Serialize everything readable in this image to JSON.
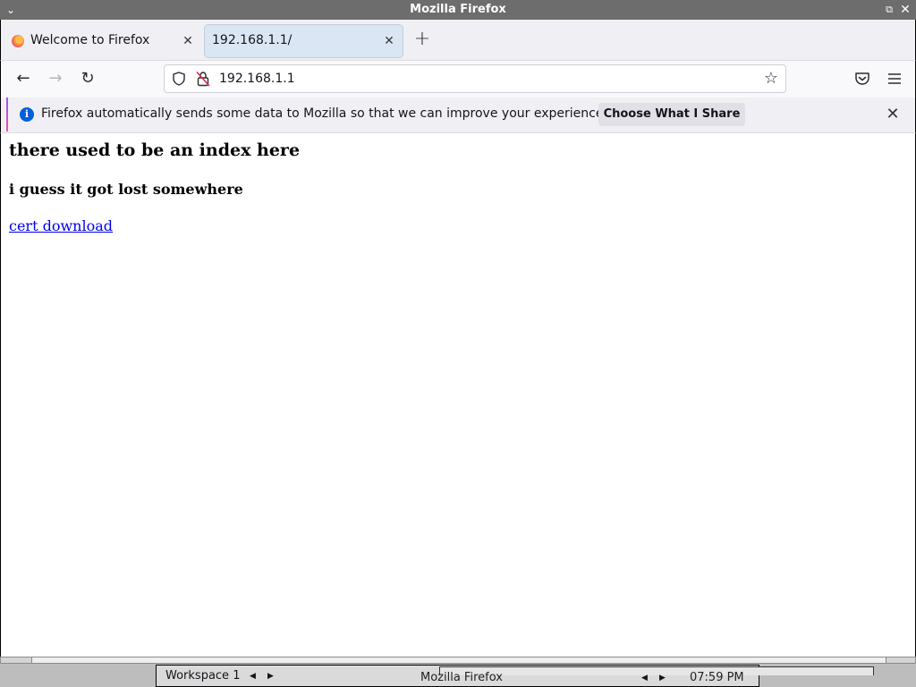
{
  "window": {
    "title": "Mozilla Firefox",
    "menu_glyph": "⌄",
    "restore_glyph": "⧉",
    "close_glyph": "✕"
  },
  "tabs": [
    {
      "label": "Welcome to Firefox",
      "active": false,
      "icon": "firefox-icon"
    },
    {
      "label": "192.168.1.1/",
      "active": true
    }
  ],
  "tab_close_glyph": "✕",
  "new_tab_glyph": "+",
  "nav": {
    "back_glyph": "←",
    "forward_glyph": "→",
    "reload_glyph": "↻",
    "url": "192.168.1.1",
    "bookmark_glyph": "☆"
  },
  "notification": {
    "info_glyph": "i",
    "message": "Firefox automatically sends some data to Mozilla so that we can improve your experience.",
    "action_label": "Choose What I Share",
    "close_glyph": "✕"
  },
  "page": {
    "heading": "there used to be an index here",
    "subheading": "i guess it got lost somewhere",
    "link": "cert download"
  },
  "panel": {
    "workspace": "Workspace 1",
    "prev_glyph": "◀",
    "next_glyph": "▶",
    "task": "Mozilla Firefox",
    "clock": "07:59 PM"
  },
  "colors": {
    "accent": "#0060df",
    "link": "#0000ee",
    "active_tab": "#dbe6f4"
  }
}
